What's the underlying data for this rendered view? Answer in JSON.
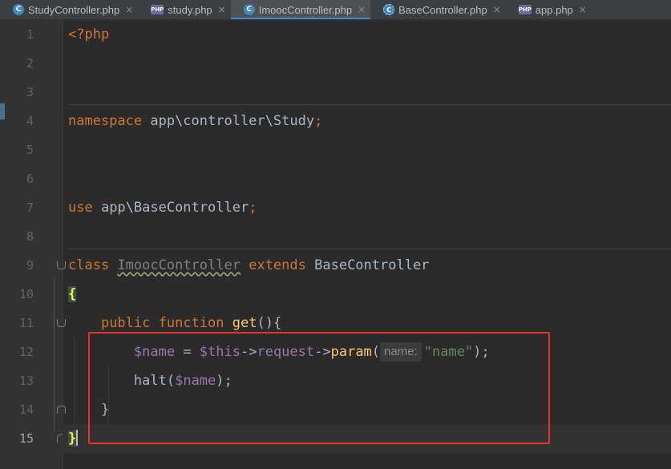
{
  "tabs": [
    {
      "label": "StudyController.php",
      "icon": "class-icon",
      "glyph": "C",
      "active": false
    },
    {
      "label": "study.php",
      "icon": "php-icon",
      "glyph": "PHP",
      "active": false
    },
    {
      "label": "ImoocController.php",
      "icon": "class-icon",
      "glyph": "C",
      "active": true
    },
    {
      "label": "BaseController.php",
      "icon": "abstract-icon",
      "glyph": "C",
      "active": false
    },
    {
      "label": "app.php",
      "icon": "php-icon",
      "glyph": "PHP",
      "active": false
    }
  ],
  "close_glyph": "×",
  "line_numbers": [
    "1",
    "2",
    "3",
    "4",
    "5",
    "6",
    "7",
    "8",
    "9",
    "10",
    "11",
    "12",
    "13",
    "14",
    "15"
  ],
  "current_line": "15",
  "code": {
    "php_open": "<?php",
    "kw_namespace": "namespace",
    "ns_path": " app\\controller\\Study",
    "semicolon": ";",
    "kw_use": "use",
    "use_path": " app\\BaseController",
    "kw_class": "class",
    "class_name": "ImoocController",
    "kw_extends": "extends",
    "parent_class": "BaseController",
    "open_brace": "{",
    "kw_public": "public",
    "kw_function": "function",
    "method_name": "get",
    "method_sig_rest": "(){",
    "var_name": "$name",
    "assign": " = ",
    "var_this": "$this",
    "arrow1": "->",
    "prop_request": "request",
    "arrow2": "->",
    "call_param": "param",
    "paren_open": "(",
    "param_hint": "name:",
    "str_name": "\"name\"",
    "paren_close_semi": ");",
    "call_halt": "halt",
    "halt_open": "(",
    "halt_arg": "$name",
    "halt_close": ");",
    "method_close": "}",
    "class_close": "}"
  },
  "colors": {
    "keyword": "#cc7832",
    "function": "#ffc66d",
    "variable": "#9876aa",
    "string": "#6a8759",
    "highlight_box": "#e8322b"
  }
}
